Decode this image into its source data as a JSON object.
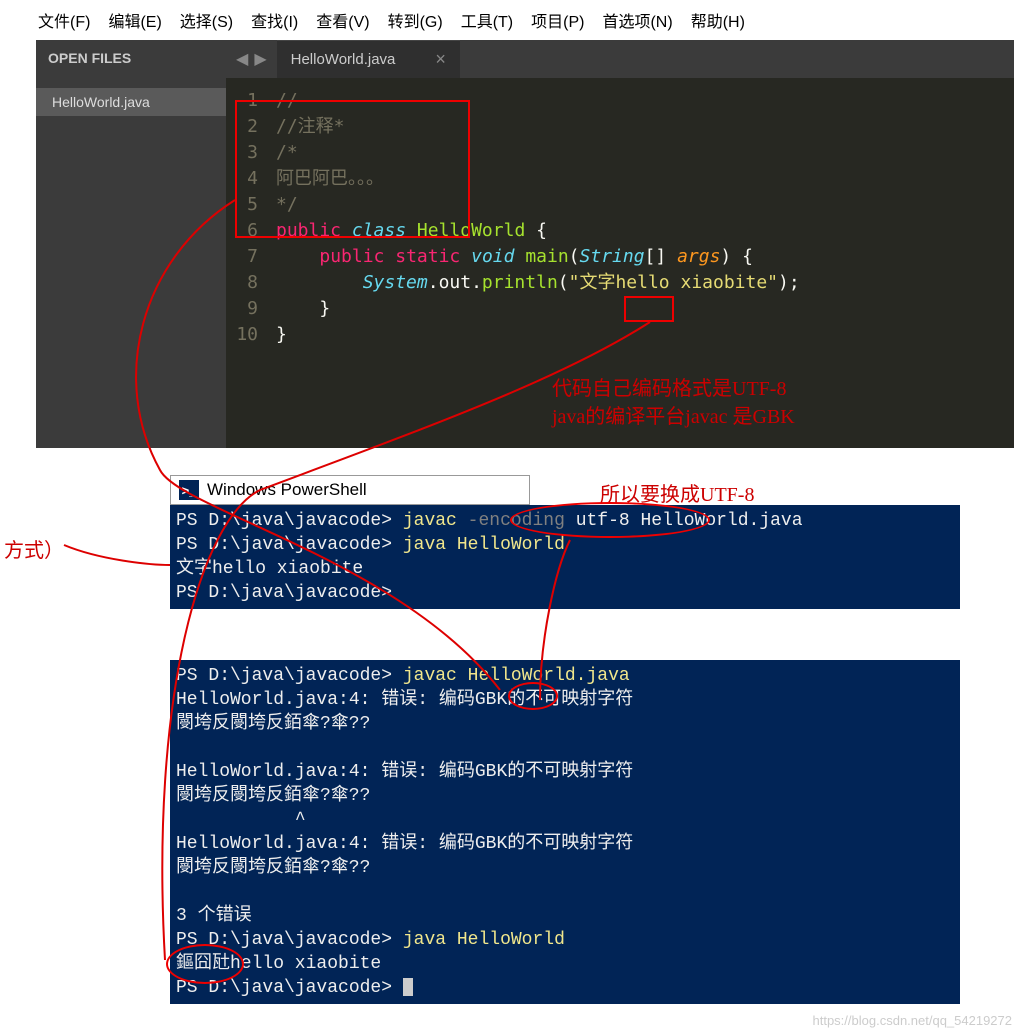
{
  "menu": [
    "文件(F)",
    "编辑(E)",
    "选择(S)",
    "查找(I)",
    "查看(V)",
    "转到(G)",
    "工具(T)",
    "项目(P)",
    "首选项(N)",
    "帮助(H)"
  ],
  "open_files_label": "OPEN FILES",
  "tab_filename": "HelloWorld.java",
  "sidebar_file": "HelloWorld.java",
  "line_numbers": [
    "1",
    "2",
    "3",
    "4",
    "5",
    "6",
    "7",
    "8",
    "9",
    "10"
  ],
  "code": {
    "l1": "//",
    "l2": "//注释*",
    "l3": "/*",
    "l4": "阿巴阿巴。。。",
    "l5": "*/",
    "l6_pub": "public",
    "l6_class": "class",
    "l6_name": "HelloWorld",
    "l6_brace": " {",
    "l7_pub": "public",
    "l7_static": "static",
    "l7_void": "void",
    "l7_main": "main",
    "l7_paren_open": "(",
    "l7_type": "String",
    "l7_brackets": "[] ",
    "l7_args": "args",
    "l7_paren_close": ") {",
    "l8_sys": "System",
    "l8_out": ".out.",
    "l8_println": "println",
    "l8_paren_open": "(",
    "l8_str": "\"文字hello xiaobite\"",
    "l8_close": ");",
    "l9": "    }",
    "l10": "}"
  },
  "annot": {
    "utf8_line1": "代码自己编码格式是UTF-8",
    "utf8_line2": "java的编译平台javac 是GBK",
    "change": "所以要换成UTF-8",
    "side": "方式）"
  },
  "ps_title": "Windows PowerShell",
  "ps1": {
    "l1_prompt": "PS D:\\java\\javacode>",
    "l1_cmd": " javac ",
    "l1_enc": "-encoding",
    "l1_utf": " utf-8 HelloWorld.java",
    "l2_prompt": "PS D:\\java\\javacode>",
    "l2_cmd": " java HelloWorld",
    "l3": "文字hello xiaobite",
    "l4_prompt": "PS D:\\java\\javacode>"
  },
  "ps2": {
    "l1_prompt": "PS D:\\java\\javacode>",
    "l1_cmd": " javac HelloWorld.java",
    "l2": "HelloWorld.java:4: 错误: 编码GBK的不可映射字符",
    "l3": "閿垮反閿垮反銆傘?傘??",
    "l4": "",
    "l5": "HelloWorld.java:4: 错误: 编码GBK的不可映射字符",
    "l6": "閿垮反閿垮反銆傘?傘??",
    "l7": "           ^",
    "l8": "HelloWorld.java:4: 错误: 编码GBK的不可映射字符",
    "l9": "閿垮反閿垮反銆傘?傘??",
    "l10": "",
    "l11": "3 个错误",
    "l12_prompt": "PS D:\\java\\javacode>",
    "l12_cmd": " java HelloWorld",
    "l13": "鏂囧瓧hello xiaobite",
    "l14_prompt": "PS D:\\java\\javacode>"
  },
  "watermark": "https://blog.csdn.net/qq_54219272"
}
